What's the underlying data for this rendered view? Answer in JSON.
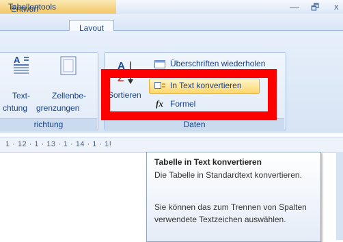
{
  "title_bar": {
    "context_title": "Tabellentools",
    "minimize_glyph": "—",
    "restore_glyph": "🗗",
    "close_glyph": "x"
  },
  "tabs": {
    "entwurf": "Entwurf",
    "layout": "Layout"
  },
  "ribbon": {
    "group_alignment": {
      "label": "richtung",
      "buttons": [
        {
          "label_line1": "Text-",
          "label_line2": "chtung",
          "icon": "text-direction-icon"
        },
        {
          "label_line1": "Zellenbe-",
          "label_line2": "grenzungen",
          "icon": "cell-margins-icon"
        }
      ]
    },
    "group_data": {
      "label": "Daten",
      "sort_label": "Sortieren",
      "items": {
        "repeat_headers": "Überschriften wiederholen",
        "convert_to_text": "In Text konvertieren",
        "formula": "Formel"
      }
    }
  },
  "ruler": {
    "text": "1 · 12 · 1 · 13 · 1 · 14 · 1 · 1!"
  },
  "tooltip": {
    "title": "Tabelle in Text konvertieren",
    "line1": "Die Tabelle in Standardtext konvertieren.",
    "line2": "Sie können das zum Trennen von Spalten verwendete Textzeichen auswählen."
  },
  "colors": {
    "highlight": "#ff0000",
    "accent": "#15428b",
    "context_tab": "#f2c766"
  }
}
